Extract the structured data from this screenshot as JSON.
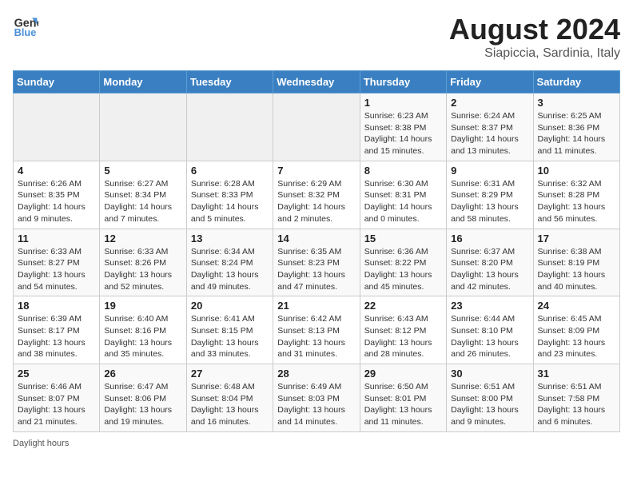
{
  "app": {
    "name": "GeneralBlue",
    "name_part1": "General",
    "name_part2": "Blue"
  },
  "title": "August 2024",
  "location": "Siapiccia, Sardinia, Italy",
  "days_of_week": [
    "Sunday",
    "Monday",
    "Tuesday",
    "Wednesday",
    "Thursday",
    "Friday",
    "Saturday"
  ],
  "footer_note": "Daylight hours",
  "weeks": [
    [
      {
        "day": "",
        "info": ""
      },
      {
        "day": "",
        "info": ""
      },
      {
        "day": "",
        "info": ""
      },
      {
        "day": "",
        "info": ""
      },
      {
        "day": "1",
        "info": "Sunrise: 6:23 AM\nSunset: 8:38 PM\nDaylight: 14 hours and 15 minutes."
      },
      {
        "day": "2",
        "info": "Sunrise: 6:24 AM\nSunset: 8:37 PM\nDaylight: 14 hours and 13 minutes."
      },
      {
        "day": "3",
        "info": "Sunrise: 6:25 AM\nSunset: 8:36 PM\nDaylight: 14 hours and 11 minutes."
      }
    ],
    [
      {
        "day": "4",
        "info": "Sunrise: 6:26 AM\nSunset: 8:35 PM\nDaylight: 14 hours and 9 minutes."
      },
      {
        "day": "5",
        "info": "Sunrise: 6:27 AM\nSunset: 8:34 PM\nDaylight: 14 hours and 7 minutes."
      },
      {
        "day": "6",
        "info": "Sunrise: 6:28 AM\nSunset: 8:33 PM\nDaylight: 14 hours and 5 minutes."
      },
      {
        "day": "7",
        "info": "Sunrise: 6:29 AM\nSunset: 8:32 PM\nDaylight: 14 hours and 2 minutes."
      },
      {
        "day": "8",
        "info": "Sunrise: 6:30 AM\nSunset: 8:31 PM\nDaylight: 14 hours and 0 minutes."
      },
      {
        "day": "9",
        "info": "Sunrise: 6:31 AM\nSunset: 8:29 PM\nDaylight: 13 hours and 58 minutes."
      },
      {
        "day": "10",
        "info": "Sunrise: 6:32 AM\nSunset: 8:28 PM\nDaylight: 13 hours and 56 minutes."
      }
    ],
    [
      {
        "day": "11",
        "info": "Sunrise: 6:33 AM\nSunset: 8:27 PM\nDaylight: 13 hours and 54 minutes."
      },
      {
        "day": "12",
        "info": "Sunrise: 6:33 AM\nSunset: 8:26 PM\nDaylight: 13 hours and 52 minutes."
      },
      {
        "day": "13",
        "info": "Sunrise: 6:34 AM\nSunset: 8:24 PM\nDaylight: 13 hours and 49 minutes."
      },
      {
        "day": "14",
        "info": "Sunrise: 6:35 AM\nSunset: 8:23 PM\nDaylight: 13 hours and 47 minutes."
      },
      {
        "day": "15",
        "info": "Sunrise: 6:36 AM\nSunset: 8:22 PM\nDaylight: 13 hours and 45 minutes."
      },
      {
        "day": "16",
        "info": "Sunrise: 6:37 AM\nSunset: 8:20 PM\nDaylight: 13 hours and 42 minutes."
      },
      {
        "day": "17",
        "info": "Sunrise: 6:38 AM\nSunset: 8:19 PM\nDaylight: 13 hours and 40 minutes."
      }
    ],
    [
      {
        "day": "18",
        "info": "Sunrise: 6:39 AM\nSunset: 8:17 PM\nDaylight: 13 hours and 38 minutes."
      },
      {
        "day": "19",
        "info": "Sunrise: 6:40 AM\nSunset: 8:16 PM\nDaylight: 13 hours and 35 minutes."
      },
      {
        "day": "20",
        "info": "Sunrise: 6:41 AM\nSunset: 8:15 PM\nDaylight: 13 hours and 33 minutes."
      },
      {
        "day": "21",
        "info": "Sunrise: 6:42 AM\nSunset: 8:13 PM\nDaylight: 13 hours and 31 minutes."
      },
      {
        "day": "22",
        "info": "Sunrise: 6:43 AM\nSunset: 8:12 PM\nDaylight: 13 hours and 28 minutes."
      },
      {
        "day": "23",
        "info": "Sunrise: 6:44 AM\nSunset: 8:10 PM\nDaylight: 13 hours and 26 minutes."
      },
      {
        "day": "24",
        "info": "Sunrise: 6:45 AM\nSunset: 8:09 PM\nDaylight: 13 hours and 23 minutes."
      }
    ],
    [
      {
        "day": "25",
        "info": "Sunrise: 6:46 AM\nSunset: 8:07 PM\nDaylight: 13 hours and 21 minutes."
      },
      {
        "day": "26",
        "info": "Sunrise: 6:47 AM\nSunset: 8:06 PM\nDaylight: 13 hours and 19 minutes."
      },
      {
        "day": "27",
        "info": "Sunrise: 6:48 AM\nSunset: 8:04 PM\nDaylight: 13 hours and 16 minutes."
      },
      {
        "day": "28",
        "info": "Sunrise: 6:49 AM\nSunset: 8:03 PM\nDaylight: 13 hours and 14 minutes."
      },
      {
        "day": "29",
        "info": "Sunrise: 6:50 AM\nSunset: 8:01 PM\nDaylight: 13 hours and 11 minutes."
      },
      {
        "day": "30",
        "info": "Sunrise: 6:51 AM\nSunset: 8:00 PM\nDaylight: 13 hours and 9 minutes."
      },
      {
        "day": "31",
        "info": "Sunrise: 6:51 AM\nSunset: 7:58 PM\nDaylight: 13 hours and 6 minutes."
      }
    ]
  ]
}
